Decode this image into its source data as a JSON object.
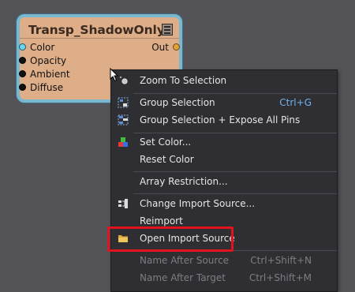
{
  "node": {
    "title": "Transp_ShadowOnly",
    "inputs": [
      "Color",
      "Opacity",
      "Ambient",
      "Diffuse"
    ],
    "output": "Out"
  },
  "context_menu": {
    "items": [
      {
        "label": "Zoom To Selection",
        "shortcut": "",
        "icon": "zoom-icon",
        "disabled": false
      },
      {
        "label": "Group Selection",
        "shortcut": "Ctrl+G",
        "icon": "group-icon",
        "disabled": false
      },
      {
        "label": "Group Selection + Expose All Pins",
        "shortcut": "",
        "icon": "group-expose-icon",
        "disabled": false
      },
      {
        "label": "Set Color...",
        "shortcut": "",
        "icon": "color-icon",
        "disabled": false
      },
      {
        "label": "Reset Color",
        "shortcut": "",
        "icon": "",
        "disabled": false
      },
      {
        "label": "Array Restriction...",
        "shortcut": "",
        "icon": "",
        "disabled": false
      },
      {
        "label": "Change Import Source...",
        "shortcut": "",
        "icon": "import-source-icon",
        "disabled": false
      },
      {
        "label": "Reimport",
        "shortcut": "",
        "icon": "",
        "disabled": false
      },
      {
        "label": "Open Import Source",
        "shortcut": "",
        "icon": "folder-icon",
        "disabled": false
      },
      {
        "label": "Name After Source",
        "shortcut": "Ctrl+Shift+N",
        "icon": "",
        "disabled": true
      },
      {
        "label": "Name After Target",
        "shortcut": "Ctrl+Shift+M",
        "icon": "",
        "disabled": true
      }
    ]
  },
  "colors": {
    "background": "#535358",
    "node_fill": "#deae88",
    "node_border": "#7bb8cf",
    "menu_bg": "#2e2e33",
    "shortcut": "#6fb3ea",
    "highlight": "#e0141e"
  }
}
